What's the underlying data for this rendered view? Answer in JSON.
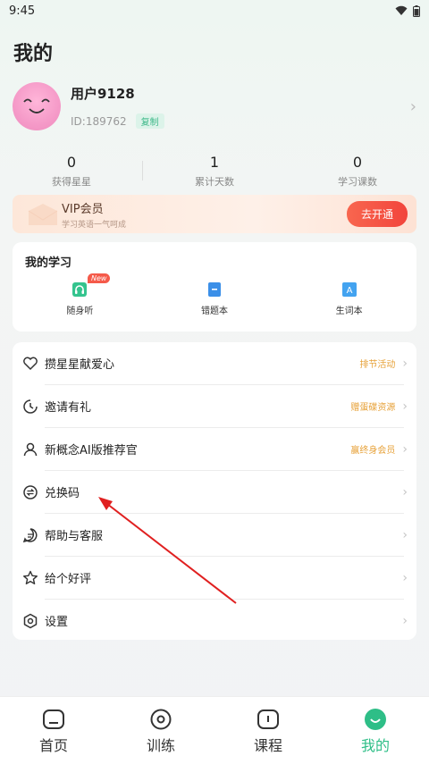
{
  "status_bar": {
    "time": "9:45"
  },
  "page": {
    "title": "我的"
  },
  "profile": {
    "username": "用户9128",
    "uid": "ID:189762",
    "copy_label": "复制"
  },
  "stats": [
    {
      "value": "0",
      "label": "获得星星"
    },
    {
      "value": "1",
      "label": "累计天数"
    },
    {
      "value": "0",
      "label": "学习课数"
    }
  ],
  "vip": {
    "title": "VIP会员",
    "subtitle": "学习英语一气呵成",
    "button": "去开通"
  },
  "study": {
    "title": "我的学习",
    "items": [
      {
        "label": "随身听",
        "badge": "New"
      },
      {
        "label": "错题本"
      },
      {
        "label": "生词本"
      }
    ]
  },
  "menu": [
    {
      "label": "攒星星献爱心",
      "tag": "排节活动"
    },
    {
      "label": "邀请有礼",
      "tag": "赠蛋碟资源"
    },
    {
      "label": "新概念AI版推荐官",
      "tag": "赢终身会员"
    },
    {
      "label": "兑换码",
      "tag": ""
    },
    {
      "label": "帮助与客服",
      "tag": ""
    },
    {
      "label": "给个好评",
      "tag": ""
    },
    {
      "label": "设置",
      "tag": ""
    }
  ],
  "tabs": [
    {
      "label": "首页"
    },
    {
      "label": "训练"
    },
    {
      "label": "课程"
    },
    {
      "label": "我的"
    }
  ],
  "colors": {
    "accent": "#2ebe87",
    "vip_button": "#f2453c",
    "tag": "#e7a23a",
    "annotation_arrow": "#e02020"
  }
}
